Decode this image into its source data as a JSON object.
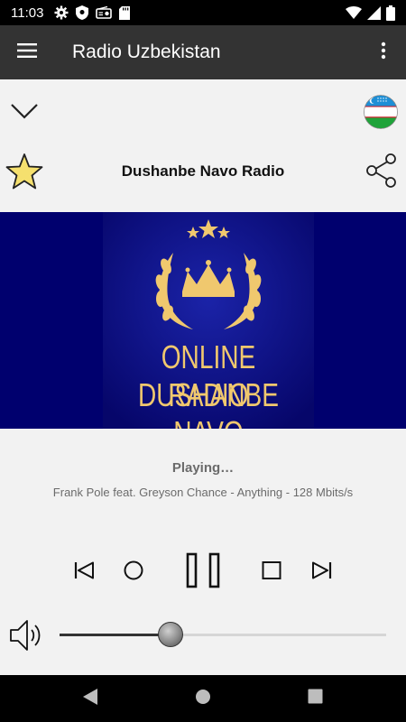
{
  "status_bar": {
    "time": "11:03",
    "left_icons": [
      "settings-icon",
      "shield-icon",
      "radio-icon",
      "sd-card-icon"
    ],
    "right_icons": [
      "wifi-icon",
      "signal-icon",
      "battery-icon"
    ]
  },
  "app_bar": {
    "title": "Radio Uzbekistan",
    "menu_icon": "hamburger-menu-icon",
    "overflow_icon": "more-vert-icon"
  },
  "station": {
    "name": "Dushanbe Navo Radio",
    "favorite_icon": "star-icon",
    "share_icon": "share-icon",
    "collapse_icon": "chevron-down-icon",
    "flag_icon": "uzbekistan-flag-icon"
  },
  "artwork": {
    "line1": "ONLINE RADIO",
    "line2": "DUSHANBE NAVO"
  },
  "player": {
    "status": "Playing…",
    "track": "Frank Pole feat. Greyson Chance - Anything - 128 Mbits/s",
    "volume_level": 0.34
  },
  "colors": {
    "app_bar": "#333333",
    "artwork_background": "#00006e",
    "artwork_text": "#f0c86e",
    "star_fill": "#f5e06e"
  }
}
